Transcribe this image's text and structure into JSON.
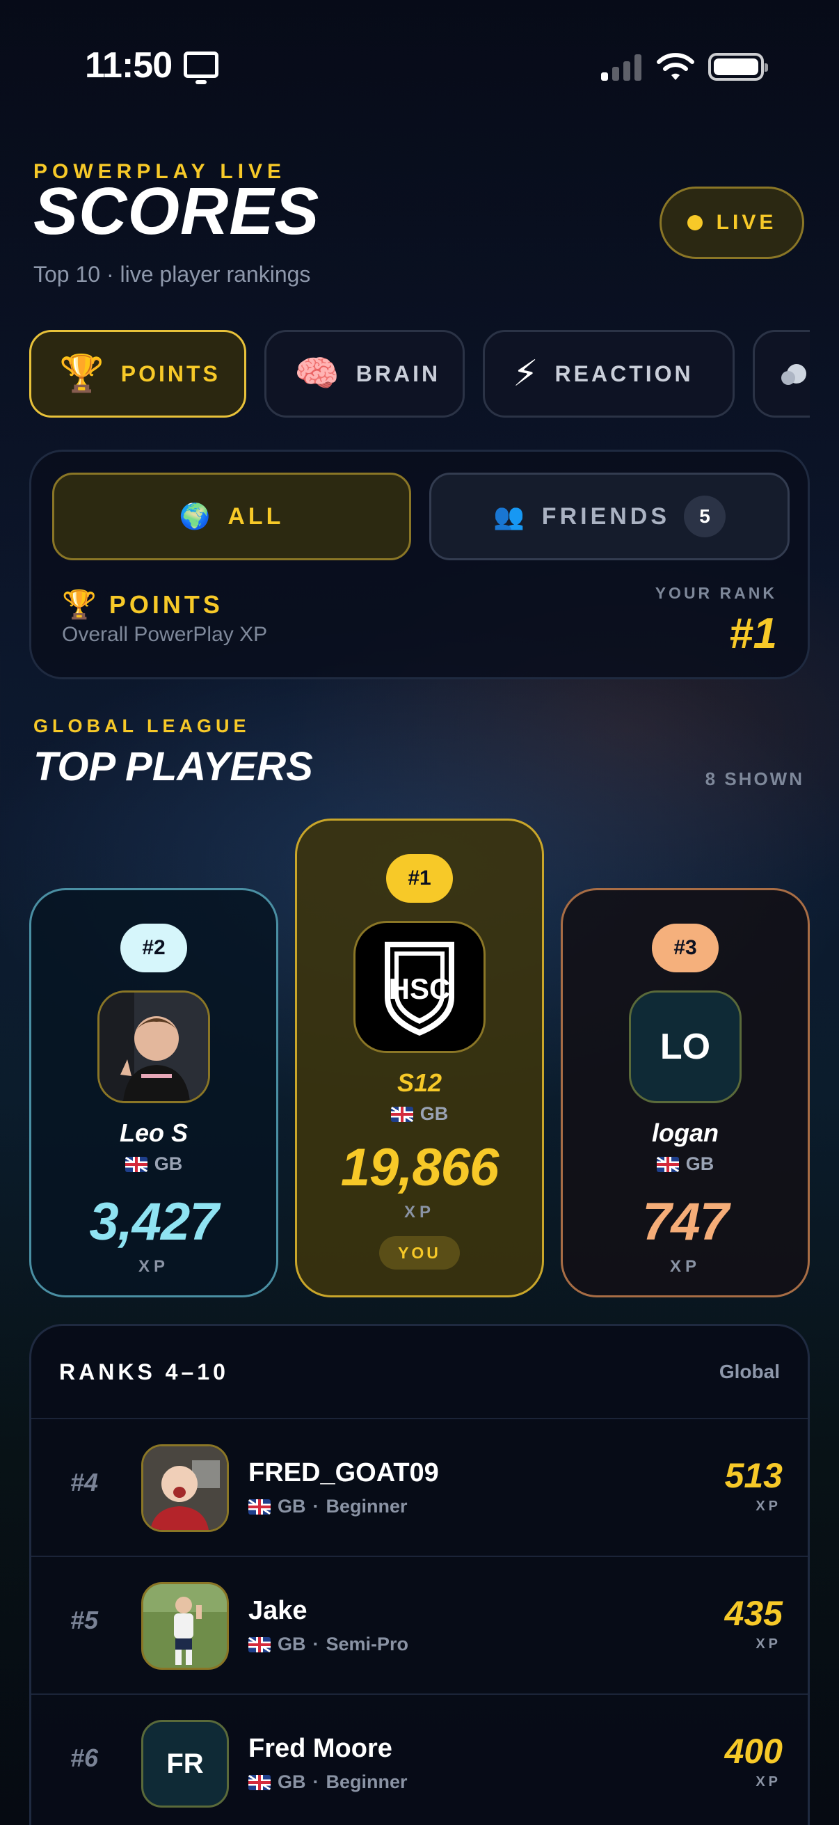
{
  "status_bar": {
    "time": "11:50"
  },
  "header": {
    "eyebrow": "POWERPLAY LIVE",
    "title": "SCORES",
    "subtitle": "Top 10 · live player rankings",
    "live_label": "LIVE"
  },
  "category_tabs": [
    {
      "label": "POINTS",
      "icon": "trophy-icon",
      "emoji": "🏆",
      "active": true
    },
    {
      "label": "BRAIN",
      "icon": "brain-icon",
      "emoji": "🧠",
      "active": false
    },
    {
      "label": "REACTION",
      "icon": "lightning-icon",
      "emoji": "⚡",
      "active": false
    }
  ],
  "filter": {
    "all": {
      "label": "ALL",
      "icon": "globe-icon",
      "emoji": "🌍"
    },
    "friends": {
      "label": "FRIENDS",
      "icon": "people-icon",
      "emoji": "👥",
      "count": "5"
    },
    "category_label": "POINTS",
    "category_emoji": "🏆",
    "category_desc": "Overall PowerPlay XP",
    "your_rank_label": "YOUR RANK",
    "your_rank": "#1"
  },
  "league": {
    "eyebrow": "GLOBAL LEAGUE",
    "title": "TOP PLAYERS",
    "shown": "8 SHOWN"
  },
  "podium": {
    "second": {
      "rank": "#2",
      "name": "Leo S",
      "country": "GB",
      "score": "3,427",
      "unit": "XP",
      "color": "#8fe3f2"
    },
    "first": {
      "rank": "#1",
      "name": "S12",
      "country": "GB",
      "score": "19,866",
      "unit": "XP",
      "you": "YOU",
      "color": "#f7c928",
      "logo_text": "HSC"
    },
    "third": {
      "rank": "#3",
      "name": "logan",
      "country": "GB",
      "score": "747",
      "unit": "XP",
      "initials": "LO",
      "color": "#f5ad78"
    }
  },
  "ranks": {
    "title": "RANKS 4–10",
    "scope": "Global",
    "rows": [
      {
        "rank": "#4",
        "name": "FRED_GOAT09",
        "country": "GB",
        "level": "Beginner",
        "score": "513",
        "unit": "XP"
      },
      {
        "rank": "#5",
        "name": "Jake",
        "country": "GB",
        "level": "Semi-Pro",
        "score": "435",
        "unit": "XP"
      },
      {
        "rank": "#6",
        "name": "Fred Moore",
        "country": "GB",
        "level": "Beginner",
        "score": "400",
        "unit": "XP",
        "initials": "FR"
      }
    ]
  }
}
